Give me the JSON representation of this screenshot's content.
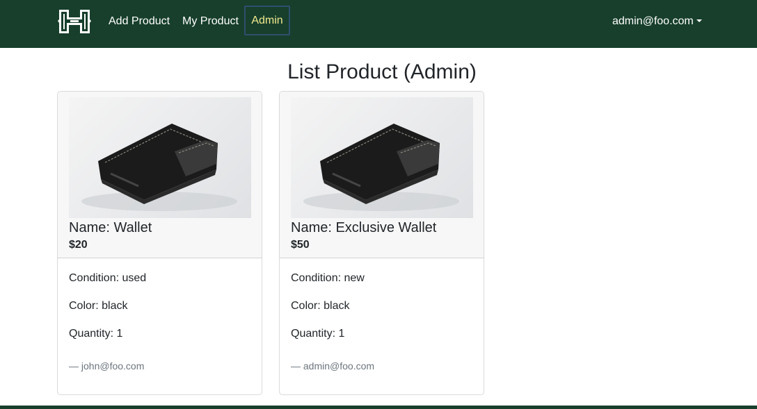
{
  "navbar": {
    "logo_icon": "hawaii-h-logo-icon",
    "links": [
      "Add Product",
      "My Product",
      "Admin"
    ],
    "active_link": "Admin",
    "user_email": "admin@foo.com",
    "colors": {
      "background": "#173f2c",
      "active_text": "#f2e98e"
    }
  },
  "page": {
    "title": "List Product (Admin)"
  },
  "products": [
    {
      "image_icon": "wallet-photo",
      "name": "Name: Wallet",
      "price": "$20",
      "condition": "Condition: used",
      "color": "Color: black",
      "quantity": "Quantity: 1",
      "owner": "— john@foo.com"
    },
    {
      "image_icon": "wallet-photo",
      "name": "Name: Exclusive Wallet",
      "price": "$50",
      "condition": "Condition: new",
      "color": "Color: black",
      "quantity": "Quantity: 1",
      "owner": "— admin@foo.com"
    }
  ]
}
